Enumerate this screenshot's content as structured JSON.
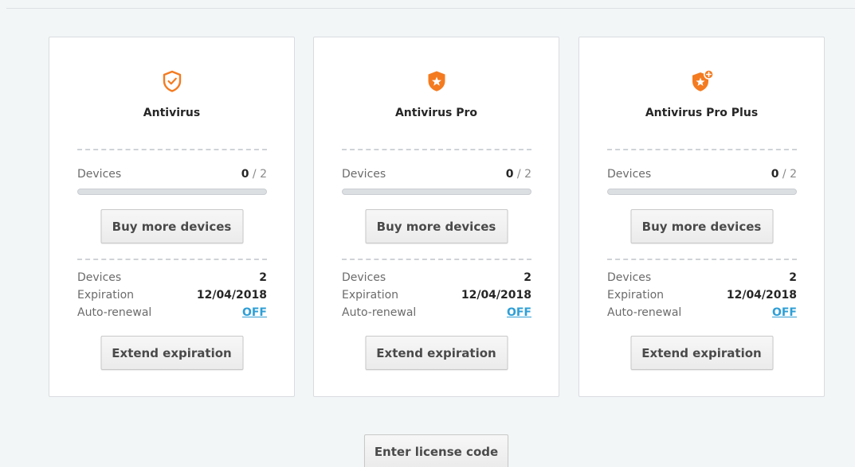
{
  "colors": {
    "accent": "#f47b20",
    "link": "#2f9fd6",
    "background": "#f3f6f7"
  },
  "cards": [
    {
      "icon": "shield-check-outline-icon",
      "title": "Antivirus",
      "devices_label": "Devices",
      "devices_used": "0",
      "devices_total": "/ 2",
      "devices_fraction": 0,
      "buy_label": "Buy more devices",
      "rows": [
        {
          "key": "Devices",
          "value": "2"
        },
        {
          "key": "Expiration",
          "value": "12/04/2018"
        },
        {
          "key": "Auto-renewal",
          "value": "OFF"
        }
      ],
      "extend_label": "Extend expiration"
    },
    {
      "icon": "shield-star-icon",
      "title": "Antivirus Pro",
      "devices_label": "Devices",
      "devices_used": "0",
      "devices_total": "/ 2",
      "devices_fraction": 0,
      "buy_label": "Buy more devices",
      "rows": [
        {
          "key": "Devices",
          "value": "2"
        },
        {
          "key": "Expiration",
          "value": "12/04/2018"
        },
        {
          "key": "Auto-renewal",
          "value": "OFF"
        }
      ],
      "extend_label": "Extend expiration"
    },
    {
      "icon": "shield-star-plus-icon",
      "title": "Antivirus Pro Plus",
      "devices_label": "Devices",
      "devices_used": "0",
      "devices_total": "/ 2",
      "devices_fraction": 0,
      "buy_label": "Buy more devices",
      "rows": [
        {
          "key": "Devices",
          "value": "2"
        },
        {
          "key": "Expiration",
          "value": "12/04/2018"
        },
        {
          "key": "Auto-renewal",
          "value": "OFF"
        }
      ],
      "extend_label": "Extend expiration"
    }
  ],
  "license_button": "Enter license code"
}
